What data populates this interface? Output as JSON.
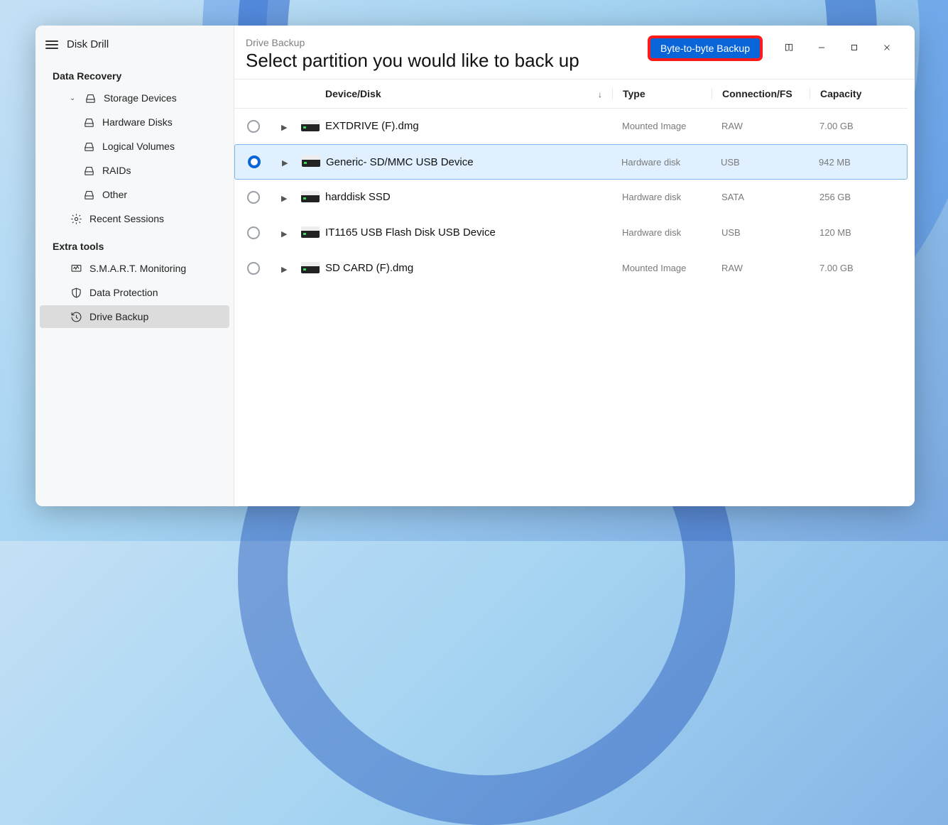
{
  "app": {
    "title": "Disk Drill"
  },
  "sidebar": {
    "sections": {
      "data_recovery": "Data Recovery",
      "extra_tools": "Extra tools"
    },
    "storage_devices": "Storage Devices",
    "hardware_disks": "Hardware Disks",
    "logical_volumes": "Logical Volumes",
    "raids": "RAIDs",
    "other": "Other",
    "recent_sessions": "Recent Sessions",
    "smart": "S.M.A.R.T. Monitoring",
    "data_protection": "Data Protection",
    "drive_backup": "Drive Backup"
  },
  "header": {
    "breadcrumb": "Drive Backup",
    "title": "Select partition you would like to back up",
    "byte_button": "Byte-to-byte Backup"
  },
  "table": {
    "headers": {
      "device": "Device/Disk",
      "type": "Type",
      "connection": "Connection/FS",
      "capacity": "Capacity"
    },
    "rows": [
      {
        "name": "EXTDRIVE (F).dmg",
        "type": "Mounted Image",
        "conn": "RAW",
        "cap": "7.00 GB",
        "selected": false
      },
      {
        "name": "Generic- SD/MMC USB Device",
        "type": "Hardware disk",
        "conn": "USB",
        "cap": "942 MB",
        "selected": true
      },
      {
        "name": "harddisk SSD",
        "type": "Hardware disk",
        "conn": "SATA",
        "cap": "256 GB",
        "selected": false
      },
      {
        "name": "IT1165 USB Flash Disk USB Device",
        "type": "Hardware disk",
        "conn": "USB",
        "cap": "120 MB",
        "selected": false
      },
      {
        "name": "SD CARD (F).dmg",
        "type": "Mounted Image",
        "conn": "RAW",
        "cap": "7.00 GB",
        "selected": false
      }
    ]
  }
}
